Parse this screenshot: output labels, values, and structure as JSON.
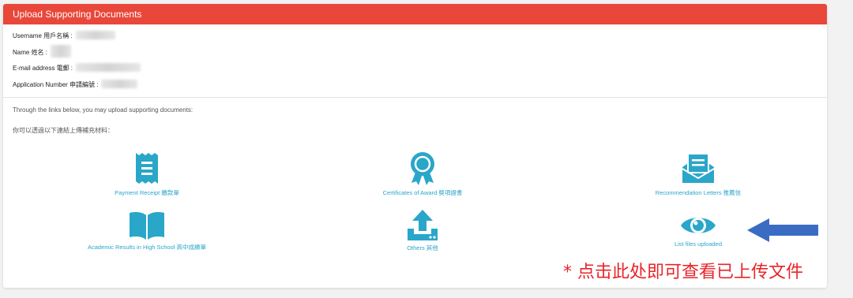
{
  "header": {
    "title": "Upload Supporting Documents"
  },
  "info": {
    "username_label": "Username 用戶名稱 :",
    "name_label": "Name 姓名 :",
    "email_label": "E-mail address 電郵 :",
    "application_label": "Application Number 申請編號 :"
  },
  "intro": {
    "line_en": "Through the links below, you may upload supporting documents:",
    "line_zh": "你可以透過以下連結上傳補充材料："
  },
  "tiles": [
    {
      "label": "Payment Receipt 繳款單",
      "icon": "receipt-icon"
    },
    {
      "label": "Certificates of Award 獎項證書",
      "icon": "award-ribbon-icon"
    },
    {
      "label": "Recommendation Letters 推薦信",
      "icon": "envelope-letter-icon"
    },
    {
      "label": "Academic Results in High School 高中成績單",
      "icon": "open-book-icon"
    },
    {
      "label": "Others 其他",
      "icon": "upload-tray-icon"
    },
    {
      "label": "List files uploaded",
      "icon": "eye-icon"
    }
  ],
  "annotation": {
    "text": "* 点击此处即可查看已上传文件"
  },
  "colors": {
    "header": "#e8473a",
    "icon": "#2aa6c9",
    "annotation": "#e8252a",
    "arrow": "#3b6cc4"
  }
}
